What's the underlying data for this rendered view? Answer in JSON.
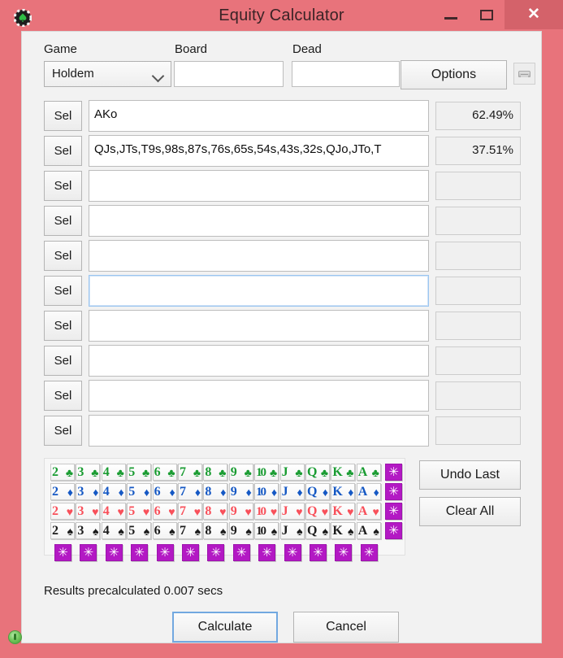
{
  "window": {
    "title": "Equity Calculator",
    "icon": "poker-chip-icon",
    "minimize_label": "—",
    "maximize_label": "□",
    "close_label": "✕",
    "frame_color": "#e8737b",
    "client_color": "#f2f2f2"
  },
  "toolbar": {
    "game_label": "Game",
    "game_value": "Holdem",
    "game_options": [
      "Holdem"
    ],
    "board_label": "Board",
    "board_value": "",
    "dead_label": "Dead",
    "dead_value": "",
    "options_label": "Options",
    "save_icon": "drawer-icon"
  },
  "players": [
    {
      "sel_label": "Sel",
      "range": "AKo",
      "equity": "62.49%",
      "focused": false
    },
    {
      "sel_label": "Sel",
      "range": "QJs,JTs,T9s,98s,87s,76s,65s,54s,43s,32s,QJo,JTo,T",
      "equity": "37.51%",
      "focused": false
    },
    {
      "sel_label": "Sel",
      "range": "",
      "equity": "",
      "focused": false
    },
    {
      "sel_label": "Sel",
      "range": "",
      "equity": "",
      "focused": false
    },
    {
      "sel_label": "Sel",
      "range": "",
      "equity": "",
      "focused": false
    },
    {
      "sel_label": "Sel",
      "range": "",
      "equity": "",
      "focused": true
    },
    {
      "sel_label": "Sel",
      "range": "",
      "equity": "",
      "focused": false
    },
    {
      "sel_label": "Sel",
      "range": "",
      "equity": "",
      "focused": false
    },
    {
      "sel_label": "Sel",
      "range": "",
      "equity": "",
      "focused": false
    },
    {
      "sel_label": "Sel",
      "range": "",
      "equity": "",
      "focused": false
    }
  ],
  "card_grid": {
    "ranks": [
      "2",
      "3",
      "4",
      "5",
      "6",
      "7",
      "8",
      "9",
      "10",
      "J",
      "Q",
      "K",
      "A"
    ],
    "suits": [
      {
        "key": "c",
        "glyph": "♣",
        "name": "clubs",
        "color": "#1a9c32"
      },
      {
        "key": "d",
        "glyph": "♦",
        "name": "diamonds",
        "color": "#1558c4"
      },
      {
        "key": "h",
        "glyph": "♥",
        "name": "hearts",
        "color": "#f8505a"
      },
      {
        "key": "s",
        "glyph": "♠",
        "name": "spades",
        "color": "#1c1c1c"
      }
    ],
    "wild_label": "✳",
    "wild_color": "#b319c4",
    "wild_column_count": 4,
    "wild_row_count": 13
  },
  "actions": {
    "undo_label": "Undo Last",
    "clear_label": "Clear All",
    "calculate_label": "Calculate",
    "cancel_label": "Cancel"
  },
  "status": {
    "result_text": "Results precalculated 0.007 secs",
    "indicator": "green-status-indicator"
  }
}
